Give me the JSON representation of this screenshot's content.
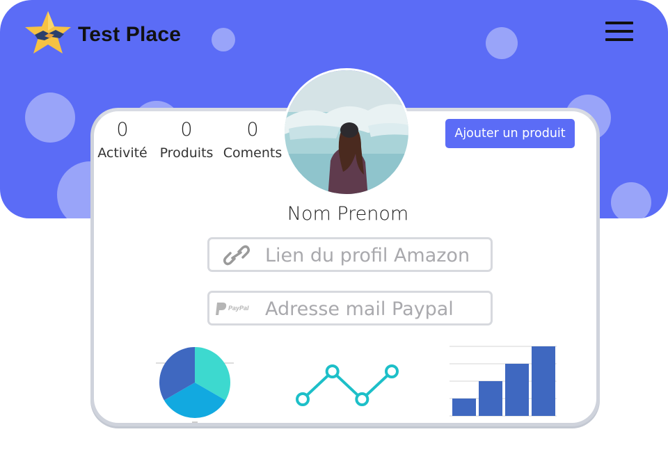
{
  "header": {
    "brand": "Test Place",
    "logo_icon": "star-logo-icon",
    "menu_icon": "hamburger-menu-icon",
    "background_color": "#5b6cf6"
  },
  "profile": {
    "stats": [
      {
        "value": "0",
        "label": "Activité"
      },
      {
        "value": "0",
        "label": "Produits"
      },
      {
        "value": "0",
        "label": "Coments"
      }
    ],
    "add_button_label": "Ajouter un produit",
    "name": "Nom Prenom",
    "avatar_icon": "profile-photo",
    "amazon_field": {
      "placeholder": "Lien du profil Amazon",
      "value": "",
      "icon": "link-icon"
    },
    "paypal_field": {
      "placeholder": "Adresse mail Paypal",
      "value": "",
      "icon": "paypal-icon",
      "icon_text": "PayPal"
    }
  },
  "chart_data": [
    {
      "type": "pie",
      "values": [
        33.3,
        33.3,
        33.3
      ],
      "colors": [
        "#3dd9cf",
        "#12a9e0",
        "#3f68c0"
      ]
    },
    {
      "type": "line",
      "x": [
        1,
        2,
        3,
        4
      ],
      "values": [
        1,
        2,
        1,
        2
      ],
      "color": "#1dbfc8"
    },
    {
      "type": "bar",
      "categories": [
        "1",
        "2",
        "3",
        "4"
      ],
      "values": [
        1,
        2,
        3,
        4
      ],
      "ylim": [
        0,
        4
      ],
      "grid": true,
      "color": "#3f68c0"
    }
  ]
}
